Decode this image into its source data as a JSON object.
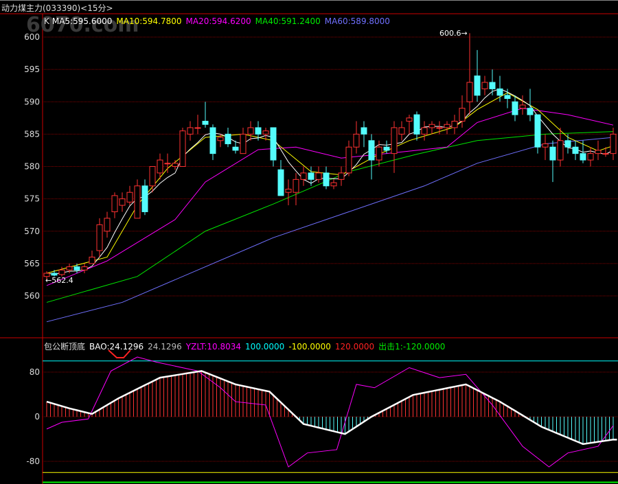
{
  "title": "动力煤主力(033390)<15分>",
  "legend_top": {
    "k": "K",
    "ma5": "MA5:595.6000",
    "ma10": "MA10:594.7800",
    "ma20": "MA20:594.6200",
    "ma40": "MA40:591.2400",
    "ma60": "MA60:589.8000"
  },
  "legend_bottom": {
    "name": "包公断顶底",
    "bao": "BAO:24.1296",
    "bao2": "24.1296",
    "yzlt": "YZLT:10.8034",
    "l100": "100.0000",
    "lm100": "-100.0000",
    "l120": "120.0000",
    "out": "出击1:-120.0000"
  },
  "colors": {
    "up": "#ff3232",
    "down": "#54fcfc",
    "ma5": "#ffffff",
    "ma10": "#ffff00",
    "ma20": "#ff00ff",
    "ma40": "#00e600",
    "ma60": "#7070ff",
    "bao": "#ffffff",
    "yzlt": "#ff00ff"
  },
  "chart_data": [
    {
      "type": "candlestick",
      "title": "动力煤主力(033390)<15分>",
      "yticks": [
        560,
        565,
        570,
        575,
        580,
        585,
        590,
        595,
        600
      ],
      "ylim": [
        555,
        602.5
      ],
      "annotations": {
        "high": "600.6",
        "low": "562.4"
      },
      "candles": [
        [
          563,
          563.8,
          562.4,
          563.5
        ],
        [
          563.5,
          564,
          563,
          563.2
        ],
        [
          563.3,
          564.5,
          563,
          564
        ],
        [
          564,
          565,
          563.5,
          564.5
        ],
        [
          564.5,
          565,
          563.5,
          564
        ],
        [
          564,
          565,
          563.5,
          564.5
        ],
        [
          565,
          567,
          565,
          566
        ],
        [
          567,
          572,
          566,
          571
        ],
        [
          570,
          573,
          569,
          572
        ],
        [
          573,
          576,
          572,
          575.5
        ],
        [
          574,
          576,
          573,
          575
        ],
        [
          574.5,
          577,
          574,
          576
        ],
        [
          572,
          578,
          572,
          577
        ],
        [
          577,
          578,
          572.5,
          573
        ],
        [
          577,
          580,
          576,
          580
        ],
        [
          579,
          582,
          578,
          581
        ],
        [
          580.5,
          582,
          579,
          580.5
        ],
        [
          580,
          581,
          579.5,
          580.5
        ],
        [
          580,
          586,
          580,
          585.5
        ],
        [
          585,
          587,
          584,
          586
        ],
        [
          586,
          588,
          585,
          586
        ],
        [
          587,
          590,
          586,
          586.5
        ],
        [
          586,
          586.5,
          581,
          582
        ],
        [
          584,
          585,
          583,
          584.5
        ],
        [
          585,
          586,
          583,
          583.5
        ],
        [
          583,
          584,
          582,
          582.5
        ],
        [
          582,
          586,
          582,
          585
        ],
        [
          585,
          587,
          584,
          586
        ],
        [
          586,
          587,
          584,
          585
        ],
        [
          585,
          586,
          584,
          585.5
        ],
        [
          586,
          586,
          580,
          581
        ],
        [
          579.5,
          581,
          576,
          575.5
        ],
        [
          576,
          578,
          574,
          576.5
        ],
        [
          576,
          579,
          574,
          578
        ],
        [
          578,
          580,
          577,
          579
        ],
        [
          579,
          580,
          577,
          578
        ],
        [
          578,
          580,
          577.5,
          579
        ],
        [
          579,
          580,
          576.5,
          577
        ],
        [
          577,
          578,
          576.5,
          577.5
        ],
        [
          578,
          580,
          577,
          579
        ],
        [
          579,
          584,
          578.5,
          583
        ],
        [
          583,
          587,
          582,
          585
        ],
        [
          586,
          587,
          583,
          585
        ],
        [
          584,
          585,
          578,
          581
        ],
        [
          581,
          584,
          580,
          583
        ],
        [
          583,
          584,
          582,
          582.5
        ],
        [
          582,
          587,
          579,
          586
        ],
        [
          585,
          587,
          584,
          586
        ],
        [
          587,
          588,
          585,
          587.5
        ],
        [
          588,
          588.5,
          584,
          585
        ],
        [
          585,
          587,
          584,
          586
        ],
        [
          586,
          587,
          585,
          586.5
        ],
        [
          586,
          587,
          585,
          586
        ],
        [
          586,
          587,
          585,
          586.5
        ],
        [
          586,
          588,
          585,
          587
        ],
        [
          587,
          591,
          586,
          589
        ],
        [
          590,
          600.6,
          588,
          593
        ],
        [
          594,
          598,
          590,
          591
        ],
        [
          592,
          594,
          591,
          593
        ],
        [
          593,
          595,
          591,
          592
        ],
        [
          592,
          594,
          590,
          591
        ],
        [
          591,
          592,
          589,
          590.5
        ],
        [
          590,
          591,
          587,
          588
        ],
        [
          589,
          591,
          588,
          589.5
        ],
        [
          589,
          592,
          587,
          588
        ],
        [
          588,
          588,
          582,
          583
        ],
        [
          583,
          585,
          581,
          583.5
        ],
        [
          583,
          584,
          577.6,
          581
        ],
        [
          581,
          586,
          580,
          584
        ],
        [
          584,
          585,
          582,
          583
        ],
        [
          583,
          584,
          581,
          582
        ],
        [
          582,
          584,
          580.5,
          581
        ],
        [
          581,
          583,
          580,
          582
        ],
        [
          582,
          584,
          581,
          582.5
        ],
        [
          582,
          583,
          581.5,
          582
        ],
        [
          582,
          586,
          581,
          585
        ]
      ],
      "ma10": [
        [
          0,
          563.5
        ],
        [
          8,
          566
        ],
        [
          12,
          574
        ],
        [
          16,
          579.7
        ],
        [
          21,
          584.5
        ],
        [
          26,
          585
        ],
        [
          30,
          584
        ],
        [
          35,
          579.2
        ],
        [
          39,
          578.7
        ],
        [
          44,
          581.9
        ],
        [
          48,
          584
        ],
        [
          54,
          586.1
        ],
        [
          57,
          588.8
        ],
        [
          61,
          591.4
        ],
        [
          65,
          588.8
        ],
        [
          69,
          584.5
        ],
        [
          73,
          582.4
        ],
        [
          75,
          583.2
        ]
      ],
      "ma20": [
        [
          0,
          561.6
        ],
        [
          8,
          565.4
        ],
        [
          17,
          571.8
        ],
        [
          21,
          577.6
        ],
        [
          28,
          582.6
        ],
        [
          33,
          583
        ],
        [
          39,
          581.3
        ],
        [
          45,
          582
        ],
        [
          53,
          583
        ],
        [
          57,
          586.8
        ],
        [
          63,
          589
        ],
        [
          69,
          588
        ],
        [
          75,
          586.4
        ]
      ],
      "ma40": [
        [
          0,
          559
        ],
        [
          12,
          563
        ],
        [
          21,
          570
        ],
        [
          30,
          574.2
        ],
        [
          40,
          579.2
        ],
        [
          49,
          581.9
        ],
        [
          57,
          584
        ],
        [
          66,
          585
        ],
        [
          75,
          585.4
        ]
      ],
      "ma60": [
        [
          0,
          556
        ],
        [
          10,
          559
        ],
        [
          20,
          564
        ],
        [
          30,
          569
        ],
        [
          40,
          573
        ],
        [
          50,
          577
        ],
        [
          57,
          580.5
        ],
        [
          66,
          583.5
        ],
        [
          75,
          584.5
        ]
      ]
    },
    {
      "type": "line",
      "title": "包公断顶底",
      "yticks": [
        80,
        0,
        -80
      ],
      "ylim": [
        -120,
        120
      ],
      "hlines": [
        100,
        -100,
        120,
        -120
      ],
      "bao": [
        [
          0,
          27
        ],
        [
          3,
          15
        ],
        [
          6,
          5
        ],
        [
          9.5,
          33
        ],
        [
          15,
          70
        ],
        [
          20.5,
          82
        ],
        [
          25,
          58
        ],
        [
          29.5,
          45
        ],
        [
          34,
          -13
        ],
        [
          39.5,
          -31
        ],
        [
          43,
          0
        ],
        [
          48.5,
          39
        ],
        [
          55.5,
          58
        ],
        [
          60,
          27
        ],
        [
          65.5,
          -18
        ],
        [
          71,
          -49
        ],
        [
          75,
          -41
        ]
      ],
      "yzlt": [
        [
          0,
          -22
        ],
        [
          2,
          -10
        ],
        [
          5.5,
          -4
        ],
        [
          8.5,
          82
        ],
        [
          12,
          107
        ],
        [
          14.5,
          98
        ],
        [
          20,
          82
        ],
        [
          23,
          52
        ],
        [
          25,
          27
        ],
        [
          29,
          21
        ],
        [
          32,
          -90
        ],
        [
          34.5,
          -65
        ],
        [
          38.4,
          -59
        ],
        [
          41,
          58
        ],
        [
          43.4,
          52
        ],
        [
          48,
          88
        ],
        [
          52,
          70
        ],
        [
          55.5,
          76
        ],
        [
          59,
          21
        ],
        [
          63,
          -53
        ],
        [
          66.5,
          -90
        ],
        [
          69,
          -65
        ],
        [
          73,
          -53
        ],
        [
          75,
          -16
        ]
      ]
    }
  ]
}
